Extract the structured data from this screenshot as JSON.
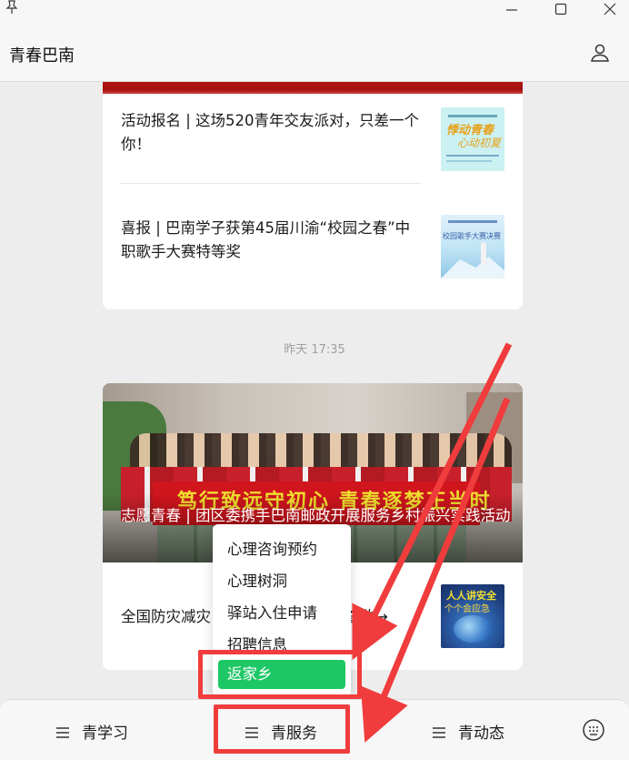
{
  "window": {
    "title": "青春巴南",
    "controls": {
      "pin": "pin-icon",
      "minimize": "minimize-icon",
      "maximize": "maximize-icon",
      "close": "close-icon"
    }
  },
  "header": {
    "title": "青春巴南",
    "profile_icon": "user-icon"
  },
  "chat": {
    "card1": {
      "articles": [
        {
          "title": "活动报名 | 这场520青年交友派对，只差一个你！",
          "thumb_text": "悸动青春",
          "thumb_sub": "心动初夏"
        },
        {
          "title": "喜报 | 巴南学子获第45届川渝“校园之春”中职歌手大赛特等奖",
          "thumb_text": "校园歌手大赛决赛"
        }
      ]
    },
    "timestamp": "昨天 17:35",
    "card2": {
      "banner_text": "笃行致远守初心  青春逐梦正当时",
      "cover_title": "志愿青春 | 团区委携手巴南邮政开展服务乡村振兴实践活动",
      "articles": [
        {
          "title": "全国防灾减灾日 | 防灾减灾知识请查收→",
          "thumb_text": "人人讲安全",
          "thumb_sub": "个个会应急"
        }
      ]
    }
  },
  "popup_menu": {
    "items": [
      {
        "label": "心理咨询预约"
      },
      {
        "label": "心理树洞"
      },
      {
        "label": "驿站入住申请"
      },
      {
        "label": "招聘信息"
      },
      {
        "label": "返家乡"
      }
    ],
    "selected_color": "#1ec765"
  },
  "bottom_bar": {
    "tabs": [
      {
        "label": "青学习"
      },
      {
        "label": "青服务"
      },
      {
        "label": "青动态"
      }
    ],
    "keyboard_icon": "keyboard-icon"
  },
  "annotation_color": "#f03c3c"
}
